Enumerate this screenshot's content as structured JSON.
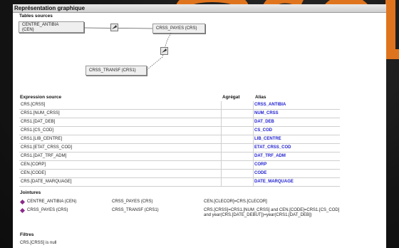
{
  "window": {
    "title": "Représentation graphique"
  },
  "tables_section": {
    "heading": "Tables sources",
    "tables": [
      {
        "label_line1": "CENTRE_ANTIBIA",
        "label_line2": "(CEN)"
      },
      {
        "label": "CRSS_PAYES (CRS)"
      },
      {
        "label": "CRSS_TRANSF (CRS1)"
      }
    ]
  },
  "columns": {
    "expression": "Expression source",
    "aggregate": "Agrégat",
    "alias": "Alias"
  },
  "rows": [
    {
      "expr": "CRS.[CRSS]",
      "agg": "",
      "alias": "CRSS_ANTIBIA"
    },
    {
      "expr": "CRS1.[NUM_CRSS]",
      "agg": "",
      "alias": "NUM_CRSS"
    },
    {
      "expr": "CRS1.[DAT_DEB]",
      "agg": "",
      "alias": "DAT_DEB"
    },
    {
      "expr": "CRS1.[CS_COD]",
      "agg": "",
      "alias": "CS_COD"
    },
    {
      "expr": "CRS1.[LIB_CENTRE]",
      "agg": "",
      "alias": "LIB_CENTRE"
    },
    {
      "expr": "CRS1.[ETAT_CRSS_COD]",
      "agg": "",
      "alias": "ETAT_CRSS_COD"
    },
    {
      "expr": "CRS1.[DAT_TRF_ADM]",
      "agg": "",
      "alias": "DAT_TRF_ADM"
    },
    {
      "expr": "CEN.[CORP]",
      "agg": "",
      "alias": "CORP"
    },
    {
      "expr": "CEN.[CODE]",
      "agg": "",
      "alias": "CODE"
    },
    {
      "expr": "CRS.[DATE_MARQUAGE]",
      "agg": "",
      "alias": "DATE_MARQUAGE"
    }
  ],
  "joins": {
    "heading": "Jointures",
    "items": [
      {
        "left": "CENTRE_ANTIBIA (CEN)",
        "right": "CRSS_PAYES (CRS)",
        "condition": "CEN.[CLECOR]=CRS.[CLECOR]",
        "condition2": ""
      },
      {
        "left": "CRSS_PAYES (CRS)",
        "right": "CRSS_TRANSF (CRS1)",
        "condition": "CRS.[CRSS]=CRS1.[NUM_CRSS] and CEN.[CODE]=CRS1.[CS_COD]",
        "condition2": "and year(CRS.[DATE_DEBUT])=year(CRS1.[DAT_DEB])"
      }
    ]
  },
  "filters": {
    "heading": "Filtres",
    "text": "CRS.[CRSS] is null"
  },
  "colors": {
    "alias": "#1f1fd0",
    "logo": "#f07c1e",
    "join_icon": "#8a2a8a"
  },
  "logo": {
    "text": "SQL"
  }
}
